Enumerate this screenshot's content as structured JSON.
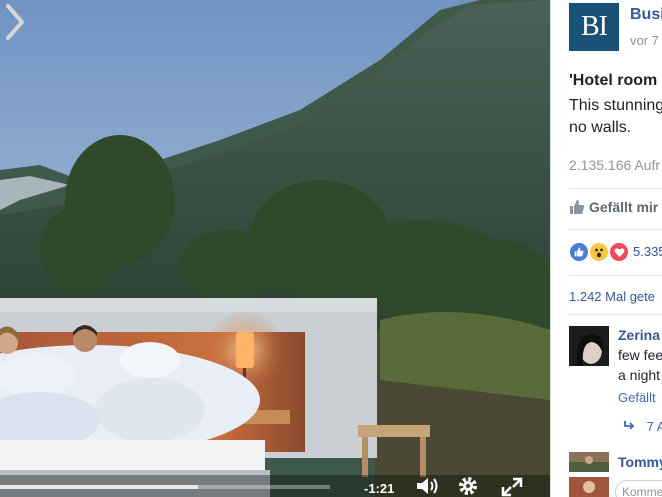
{
  "video": {
    "time_remaining": "-1:21",
    "progress": 0.6
  },
  "post": {
    "page_name": "Busi",
    "time": "vor 7",
    "avatar_text": "BI",
    "title": "'Hotel room",
    "text_line1": "This stunning",
    "text_line2": "no walls.",
    "views": "2.135.166 Aufr",
    "like_label": "Gefällt mir",
    "reaction_count": "5.335",
    "shares": "1.242 Mal gete"
  },
  "comments": [
    {
      "name": "Zerina",
      "line1": "few fee",
      "line2": "a night",
      "like_action": "Gefällt",
      "reply_count": "7 A"
    },
    {
      "name": "Tommy"
    }
  ],
  "comment_input": {
    "placeholder": "Komme"
  },
  "colors": {
    "link": "#365899",
    "brand_bi": "#1a5176"
  }
}
